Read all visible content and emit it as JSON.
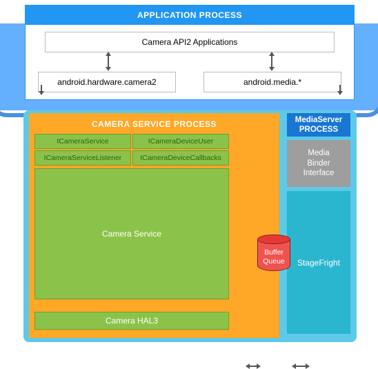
{
  "app_process": {
    "title": "APPLICATION PROCESS",
    "api2_label": "Camera API2 Applications",
    "hw_camera2": "android.hardware.camera2",
    "media_pkg": "android.media.*"
  },
  "camera_service_process": {
    "title": "CAMERA SERVICE PROCESS",
    "aidl": {
      "icamera_service": "ICameraService",
      "icamera_device_user": "ICameraDeviceUser",
      "icamera_service_listener": "ICameraServiceListener",
      "icamera_device_callbacks": "ICameraDeviceCallbacks"
    },
    "camera_service": "Camera Service",
    "camera_hal3": "Camera HAL3"
  },
  "mediaserver_process": {
    "title_line1": "MediaServer",
    "title_line2": "PROCESS",
    "media_binder": "Media\nBinder\nInterface",
    "stagefright": "StageFright"
  },
  "buffer_queue": "Buffer\nQueue",
  "colors": {
    "blue_header": "#2196f3",
    "blue_band": "#64b0ff",
    "teal_bg": "#5ccae8",
    "orange": "#ffa726",
    "green": "#8bc34a",
    "blue_dark": "#1976d2",
    "gray": "#9e9e9e",
    "cyan": "#29b6ce",
    "red": "#ef5350"
  }
}
